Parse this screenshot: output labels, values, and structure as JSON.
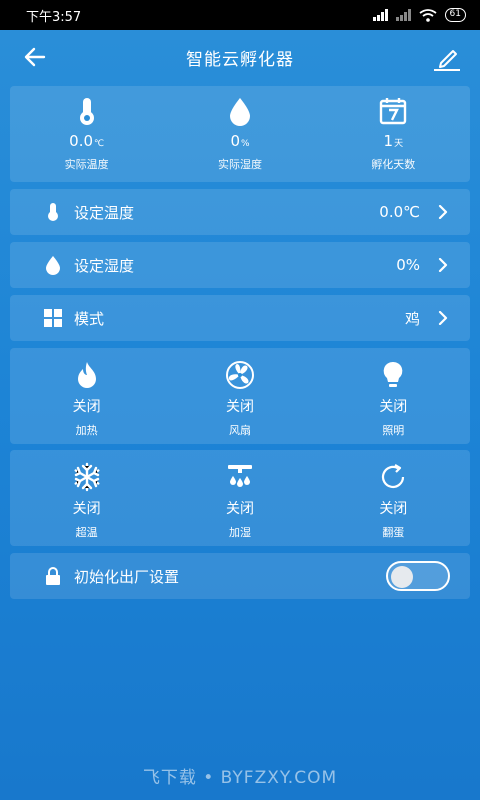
{
  "status": {
    "time": "下午3:57",
    "battery": "61"
  },
  "header": {
    "title": "智能云孵化器"
  },
  "stats": [
    {
      "value": "0.0",
      "unit": "℃",
      "label": "实际温度",
      "icon": "thermometer-icon"
    },
    {
      "value": "0",
      "unit": "%",
      "label": "实际湿度",
      "icon": "water-drop-icon"
    },
    {
      "value": "1",
      "unit": "天",
      "label": "孵化天数",
      "icon": "calendar-icon"
    }
  ],
  "settings": [
    {
      "label": "设定温度",
      "value": "0.0℃",
      "icon": "thermometer-icon"
    },
    {
      "label": "设定湿度",
      "value": "0%",
      "icon": "water-drop-icon"
    },
    {
      "label": "模式",
      "value": "鸡",
      "icon": "grid-icon"
    }
  ],
  "controls_row1": [
    {
      "state": "关闭",
      "name": "加热",
      "icon": "flame-icon"
    },
    {
      "state": "关闭",
      "name": "风扇",
      "icon": "fan-icon"
    },
    {
      "state": "关闭",
      "name": "照明",
      "icon": "bulb-icon"
    }
  ],
  "controls_row2": [
    {
      "state": "关闭",
      "name": "超温",
      "icon": "snowflake-icon"
    },
    {
      "state": "关闭",
      "name": "加湿",
      "icon": "humidifier-icon"
    },
    {
      "state": "关闭",
      "name": "翻蛋",
      "icon": "rotate-icon"
    }
  ],
  "reset": {
    "label": "初始化出厂设置",
    "icon": "lock-icon",
    "enabled": false
  },
  "watermark": "飞下载 • BYFZXY.COM"
}
